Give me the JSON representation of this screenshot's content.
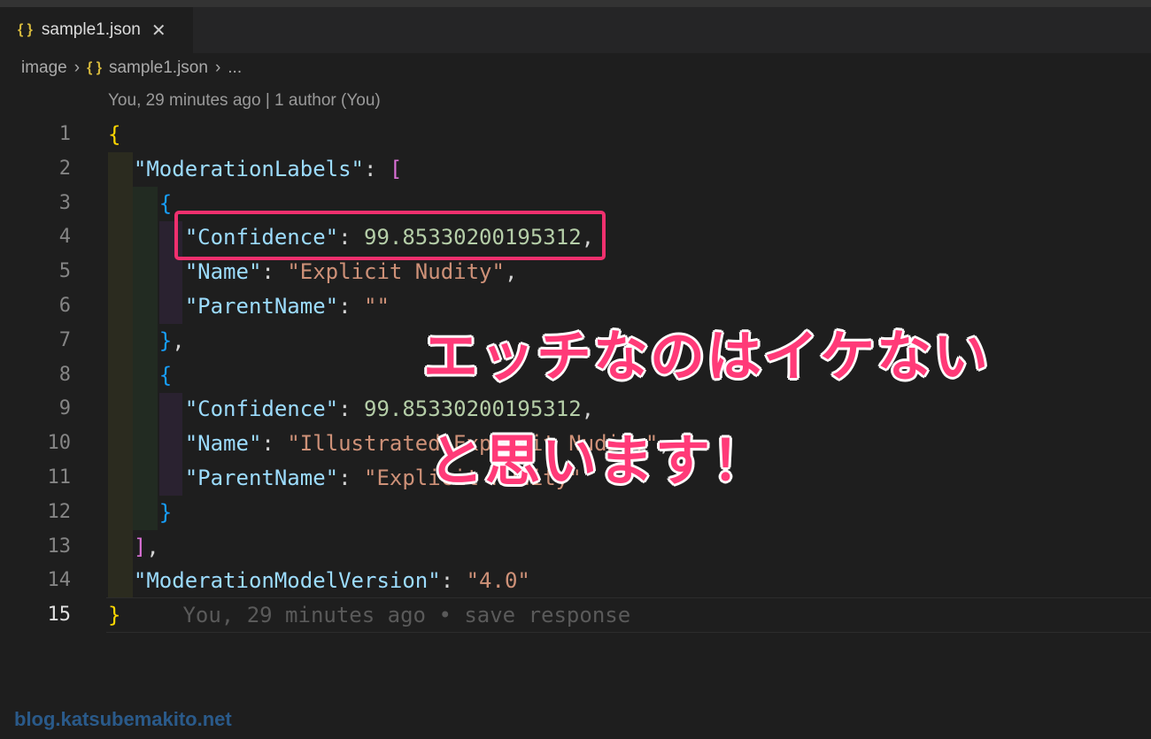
{
  "tab": {
    "label": "sample1.json",
    "icon": "json-braces-icon"
  },
  "breadcrumb": [
    "image",
    "sample1.json",
    "..."
  ],
  "blame_header": "You, 29 minutes ago | 1 author (You)",
  "code": {
    "line_numbers": [
      "1",
      "2",
      "3",
      "4",
      "5",
      "6",
      "7",
      "8",
      "9",
      "10",
      "11",
      "12",
      "13",
      "14",
      "15"
    ],
    "k_moderation_labels": "\"ModerationLabels\"",
    "k_confidence": "\"Confidence\"",
    "k_name": "\"Name\"",
    "k_parent": "\"ParentName\"",
    "k_version": "\"ModerationModelVersion\"",
    "v_conf1": "99.85330200195312",
    "v_conf2": "99.85330200195312",
    "v_name1": "\"Explicit Nudity\"",
    "v_parent1": "\"\"",
    "v_name2": "\"Illustrated Explicit Nudity\"",
    "v_parent2": "\"Explicit Nudity\"",
    "v_version": "\"4.0\"",
    "inline_blame": "You, 29 minutes ago • save response"
  },
  "overlay": {
    "line1": "エッチなのはイケない",
    "line2": "と思います！"
  },
  "watermark": "blog.katsubemakito.net"
}
